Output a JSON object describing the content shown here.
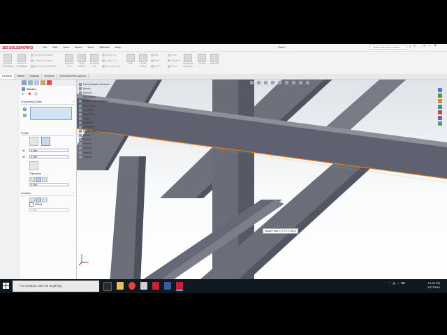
{
  "app": {
    "name": "SOLIDWORKS",
    "title": "Part1 *",
    "menu": [
      "File",
      "Edit",
      "View",
      "Insert",
      "Tools",
      "Window",
      "Help"
    ],
    "search_placeholder": "Search files and models"
  },
  "ribbon": {
    "buttons": [
      {
        "label": "Extruded Boss/Base",
        "icon": "extrude-icon"
      },
      {
        "label": "Revolved Boss/Base",
        "icon": "revolve-icon"
      },
      {
        "label": "Extruded Cut",
        "icon": "cut-extrude-icon"
      },
      {
        "label": "Hole Wizard",
        "icon": "hole-icon"
      },
      {
        "label": "Revolved Cut",
        "icon": "cut-revolve-icon"
      },
      {
        "label": "Fillet",
        "icon": "fillet-icon"
      },
      {
        "label": "Linear Pattern",
        "icon": "pattern-icon"
      },
      {
        "label": "Rib",
        "icon": "rib-icon"
      },
      {
        "label": "Reference Geometry",
        "icon": "reference-icon"
      },
      {
        "label": "Curves",
        "icon": "curves-icon"
      },
      {
        "label": "Instant3D",
        "icon": "instant3d-icon"
      }
    ],
    "small": [
      "Swept Boss/Base",
      "Lofted Boss/Base",
      "Boundary Boss/Base",
      "Swept Cut",
      "Lofted Cut",
      "Boundary Cut",
      "Draft",
      "Shell",
      "Wrap",
      "Intersect",
      "Mirror"
    ]
  },
  "tabs": [
    "Features",
    "Sketch",
    "Evaluate",
    "DimXpert",
    "SOLIDWORKS Add-Ins"
  ],
  "property_manager": {
    "title": "Gusset",
    "supporting_faces_label": "Supporting Faces",
    "profile_label": "Profile",
    "d1": "3.00in",
    "d2": "3.00in",
    "thickness_label": "Thickness",
    "thickness_value": "0.25in",
    "location_label": "Location",
    "offset_label": "Offset",
    "offset_value": "0.25in"
  },
  "feature_tree": [
    "Part1 (Default<<Default>...",
    "History",
    "Sensors",
    "Annotations",
    "Material <not specified>",
    "Front Plane",
    "Top Plane",
    "Right Plane",
    "Origin",
    "Weldment",
    "3D Sketch1",
    "Square tube 2 X 2 X 0...",
    "Mirror1",
    "Mirror2",
    "Gusset1",
    "Gusset2",
    "Gusset3",
    "Gusset4"
  ],
  "tooltip": "Square tube 2 X 2 X 0.25(1)",
  "bottom_tabs": [
    "Model",
    "Motion Study 1"
  ],
  "status": {
    "left": "SOLIDWORKS Professional 2016 x64 Edition",
    "mode": "Editing Part",
    "units": "IPS"
  },
  "taskbar": {
    "cortana": "I'm Cortana. Ask me anything.",
    "time": "12:08 PM",
    "date": "1/27/2016"
  },
  "colors": {
    "brand_red": "#d3202f",
    "tube_face": "#5e6370",
    "highlight": "#e07a20",
    "taskbar": "#101820"
  }
}
